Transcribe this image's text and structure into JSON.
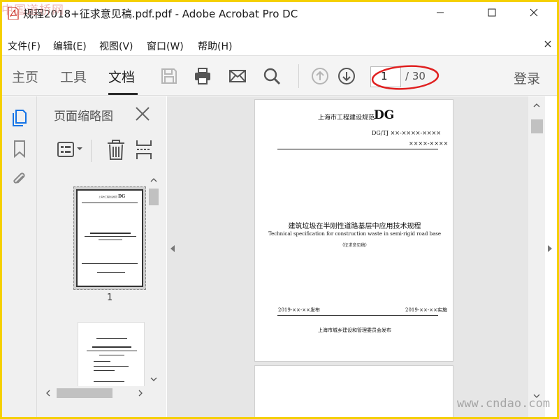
{
  "window": {
    "title": "规程2018+征求意见稿.pdf.pdf - Adobe Acrobat Pro DC"
  },
  "menu": {
    "items": [
      {
        "label": "文件(F)"
      },
      {
        "label": "编辑(E)"
      },
      {
        "label": "视图(V)"
      },
      {
        "label": "窗口(W)"
      },
      {
        "label": "帮助(H)"
      }
    ]
  },
  "toolbar": {
    "tabs": [
      {
        "label": "主页",
        "active": false
      },
      {
        "label": "工具",
        "active": false
      },
      {
        "label": "文档",
        "active": true
      }
    ],
    "icons": [
      "save-icon",
      "print-icon",
      "email-icon",
      "search-icon",
      "page-up-icon",
      "page-down-icon"
    ],
    "page_current": "1",
    "page_total": "/ 30",
    "login_label": "登录",
    "highlight_color": "#e02020"
  },
  "left_rail": {
    "icons": [
      "page-thumbnails-icon",
      "bookmark-icon",
      "attachment-icon"
    ],
    "active_color": "#1473e6"
  },
  "thumbnail_panel": {
    "title": "页面缩略图",
    "tools": [
      "thumbnail-options-icon",
      "delete-page-icon",
      "insert-page-icon"
    ],
    "pages": [
      {
        "number": "1"
      }
    ]
  },
  "document": {
    "page1": {
      "header_org": "上海市工程建设规范",
      "header_code": "DG",
      "code_line1": "DG/TJ ××-××××-××××",
      "code_line2": "××××-××××",
      "title_cn": "建筑垃圾在半刚性道路基层中应用技术规程",
      "title_en": "Technical specification for construction waste in semi-rigid road base",
      "draft_note": "（征求意见稿）",
      "issue_date": "2019-××-××发布",
      "effective_date": "2019-××-××实施",
      "issuer": "上海市城乡建设和管理委员会发布"
    }
  },
  "watermarks": {
    "top_left": "中国道桥网",
    "bottom_right": "www.cndao.com"
  }
}
